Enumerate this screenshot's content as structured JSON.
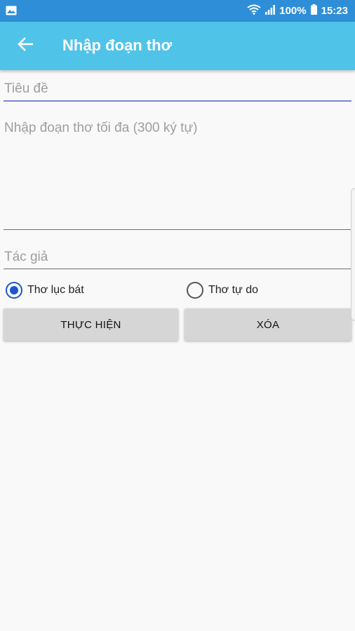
{
  "status_bar": {
    "battery": "100%",
    "time": "15:23",
    "icons": [
      "image-icon",
      "wifi-icon",
      "signal-icon",
      "battery-icon"
    ]
  },
  "app_bar": {
    "title": "Nhập đoạn thơ",
    "back_icon": "arrow-left-icon",
    "color": "#50c3e8"
  },
  "form": {
    "title_placeholder": "Tiêu đề",
    "poem_placeholder": "Nhập đoạn thơ tối đa (300 ký tự)",
    "author_placeholder": "Tác giả",
    "radio_options": [
      {
        "label": "Thơ lục bát",
        "checked": true
      },
      {
        "label": "Thơ tự do",
        "checked": false
      }
    ],
    "submit_label": "THỰC HIỆN",
    "clear_label": "XÓA",
    "accent_color": "#1e55c9"
  }
}
